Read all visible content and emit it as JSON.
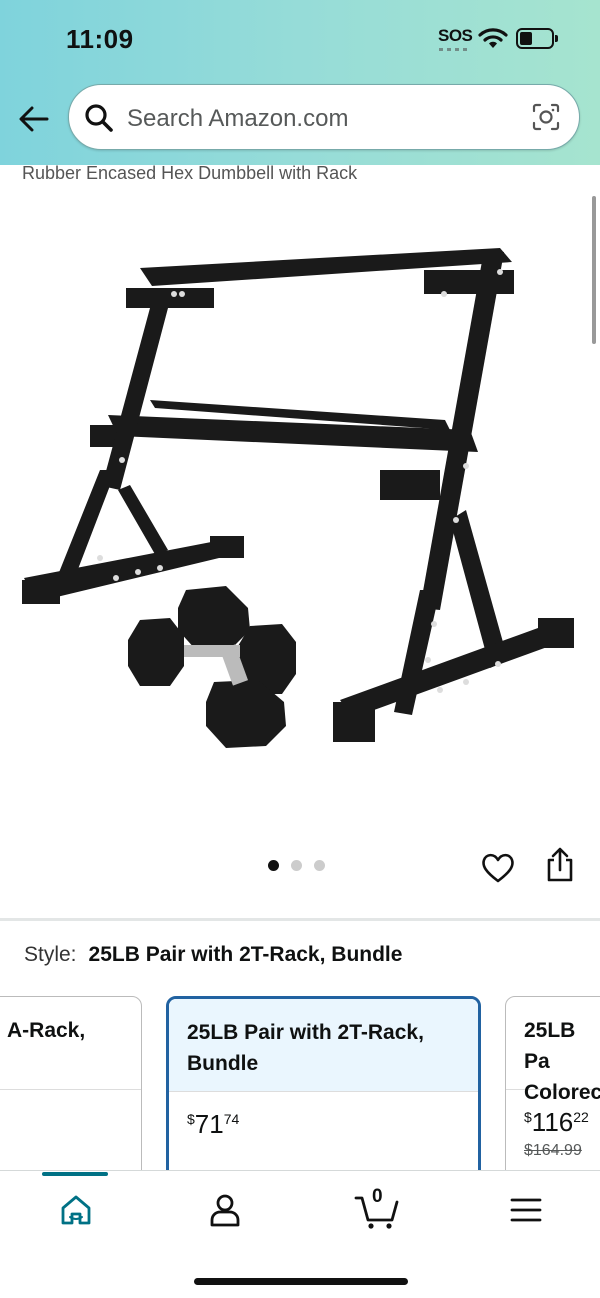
{
  "status_bar": {
    "time": "11:09",
    "sos": "SOS"
  },
  "search": {
    "placeholder": "Search Amazon.com"
  },
  "product": {
    "title": "Rubber Encased Hex Dumbbell with Rack",
    "image_dots": 3,
    "active_dot": 0
  },
  "style": {
    "label": "Style:",
    "value": "25LB Pair with 2T-Rack, Bundle"
  },
  "options": [
    {
      "title": "A-Rack,",
      "price_symbol": "",
      "price_whole": "",
      "price_cents": "",
      "list_price": ""
    },
    {
      "title": "25LB Pair with 2T-Rack, Bundle",
      "price_symbol": "$",
      "price_whole": "71",
      "price_cents": "74",
      "list_price": ""
    },
    {
      "title": "25LB Pa Colorec",
      "price_symbol": "$",
      "price_whole": "116",
      "price_cents": "22",
      "list_price": "$164.99"
    }
  ],
  "cart": {
    "count": "0"
  },
  "colors": {
    "accent": "#007185",
    "selected_border": "#2162a1",
    "selected_bg": "#eaf6fe"
  },
  "icons": [
    "back-arrow-icon",
    "search-icon",
    "camera-icon",
    "heart-icon",
    "share-icon",
    "home-icon",
    "account-icon",
    "cart-icon",
    "menu-icon"
  ]
}
